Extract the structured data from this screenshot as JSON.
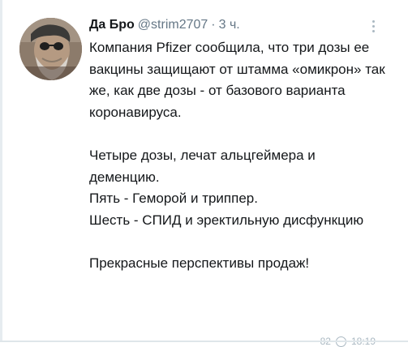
{
  "tweet": {
    "display_name": "Да Бро",
    "handle": "@strim2707",
    "separator": "·",
    "timestamp": "3 ч.",
    "paragraphs": [
      "Компания Pfizer сообщила, что три дозы ее вакцины защищают от штамма «омикрон» так же, как две дозы - от базового варианта коронавируса.",
      "",
      "Четыре дозы, лечат альцгеймера и деменцию.",
      "Пять - Геморой и триппер.",
      "Шесть - СПИД и эректильную дисфункцию",
      "",
      "Прекрасные перспективы продаж!"
    ]
  },
  "footer": {
    "left_text": "82",
    "right_text": "18:19"
  },
  "colors": {
    "text": "#14171a",
    "secondary": "#657786",
    "muted": "#aab8c2",
    "background": "#ffffff"
  },
  "icons": {
    "more": "more-vertical-icon",
    "footer": "circle-icon"
  }
}
